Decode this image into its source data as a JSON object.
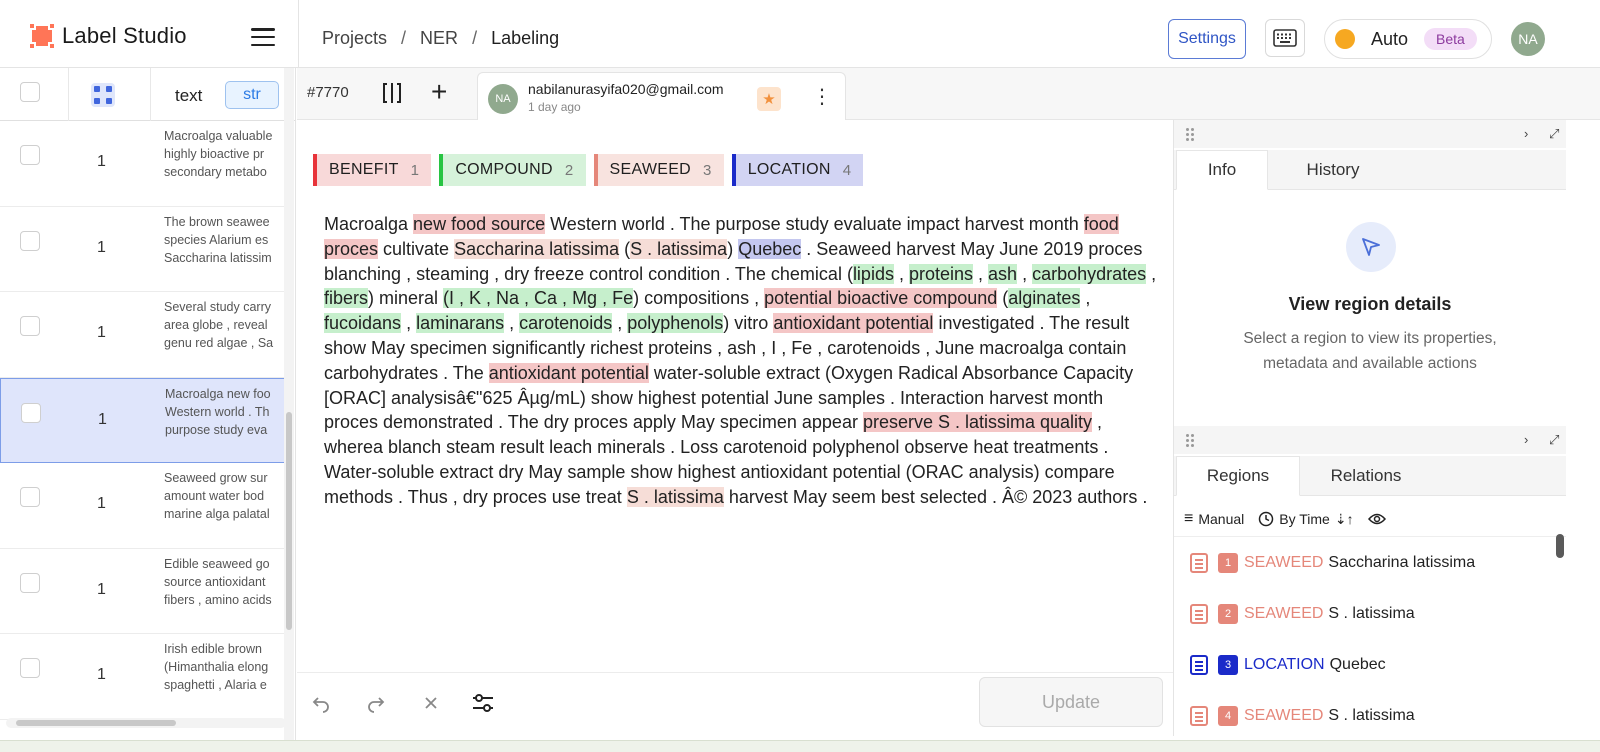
{
  "app": {
    "name": "Label Studio",
    "avatar_initials": "NA",
    "brand_color": "#ff7557"
  },
  "breadcrumb": [
    "Projects",
    "NER",
    "Labeling"
  ],
  "breadcrumb_sep": "/",
  "topbar": {
    "settings_label": "Settings",
    "auto_label": "Auto",
    "beta_label": "Beta",
    "keyboard_icon": "keyboard-icon",
    "menu_icon": "hamburger-icon"
  },
  "tasklist": {
    "columns": {
      "text": "text",
      "type_badge": "str"
    },
    "rows": [
      {
        "count": "1",
        "lines": [
          "Macroalga valuable",
          "highly bioactive pr",
          "secondary metabo"
        ],
        "selected": false
      },
      {
        "count": "1",
        "lines": [
          "The brown seawee",
          "species Alarium es",
          "Saccharina latissim"
        ],
        "selected": false
      },
      {
        "count": "1",
        "lines": [
          "Several study carry",
          "area globe , reveal",
          "genu red algae , Sa"
        ],
        "selected": false
      },
      {
        "count": "1",
        "lines": [
          "Macroalga new foo",
          "Western world . Th",
          "purpose study eva"
        ],
        "selected": true
      },
      {
        "count": "1",
        "lines": [
          "Seaweed grow sur",
          "amount water bod",
          "marine alga palatal"
        ],
        "selected": false
      },
      {
        "count": "1",
        "lines": [
          "Edible seaweed go",
          "source antioxidant",
          "fibers , amino acids"
        ],
        "selected": false
      },
      {
        "count": "1",
        "lines": [
          "Irish edible brown",
          "(Himanthalia elong",
          "spaghetti , Alaria e"
        ],
        "selected": false
      }
    ]
  },
  "taskbar": {
    "task_id": "#7770",
    "annotator_email": "nabilanurasyifa020@gmail.com",
    "annotator_initials": "NA",
    "time_ago": "1 day ago"
  },
  "labels": [
    {
      "name": "BENEFIT",
      "hotkey": "1",
      "color": "#e8343a",
      "bg": "#f8d9d9"
    },
    {
      "name": "COMPOUND",
      "hotkey": "2",
      "color": "#27c442",
      "bg": "#d6f2da"
    },
    {
      "name": "SEAWEED",
      "hotkey": "3",
      "color": "#e5877a",
      "bg": "#f8e3df"
    },
    {
      "name": "LOCATION",
      "hotkey": "4",
      "color": "#1b2bc9",
      "bg": "#d2d4f3"
    }
  ],
  "document": [
    {
      "t": "Macroalga "
    },
    {
      "t": "new food source",
      "l": "ben"
    },
    {
      "t": " Western world . The purpose study evaluate impact harvest month "
    },
    {
      "t": "food proces",
      "l": "ben"
    },
    {
      "t": " cultivate "
    },
    {
      "t": "Saccharina latissima",
      "l": "sea"
    },
    {
      "t": " ("
    },
    {
      "t": "S . latissima",
      "l": "sea"
    },
    {
      "t": ") "
    },
    {
      "t": "Quebec",
      "l": "loc"
    },
    {
      "t": " . Seaweed harvest May June 2019 proces blanching , steaming , dry freeze control condition . The chemical ("
    },
    {
      "t": "lipids",
      "l": "com"
    },
    {
      "t": " , "
    },
    {
      "t": "proteins",
      "l": "com"
    },
    {
      "t": " , "
    },
    {
      "t": "ash",
      "l": "com"
    },
    {
      "t": " , "
    },
    {
      "t": "carbohydrates",
      "l": "com"
    },
    {
      "t": " , "
    },
    {
      "t": "fibers",
      "l": "com"
    },
    {
      "t": ") mineral "
    },
    {
      "t": "(I , K , Na , Ca , Mg , Fe",
      "l": "com"
    },
    {
      "t": ") compositions , "
    },
    {
      "t": "potential bioactive compound",
      "l": "ben"
    },
    {
      "t": " ("
    },
    {
      "t": "alginates",
      "l": "com"
    },
    {
      "t": " , "
    },
    {
      "t": "fucoidans",
      "l": "com"
    },
    {
      "t": " , "
    },
    {
      "t": "laminarans",
      "l": "com"
    },
    {
      "t": " , "
    },
    {
      "t": "carotenoids",
      "l": "com"
    },
    {
      "t": " , "
    },
    {
      "t": "polyphenols",
      "l": "com"
    },
    {
      "t": ") vitro "
    },
    {
      "t": "antioxidant potential",
      "l": "ben"
    },
    {
      "t": " investigated . The result show May specimen significantly richest proteins , ash , I , Fe , carotenoids , June macroalga contain carbohydrates . The "
    },
    {
      "t": "antioxidant potential",
      "l": "ben"
    },
    {
      "t": " water-soluble extract (Oxygen Radical Absorbance Capacity [ORAC] analysisâ€\"625 Âµg/mL) show highest potential June samples . Interaction harvest month proces demonstrated . The dry proces apply May specimen appear "
    },
    {
      "t": "preserve S . latissima quality",
      "l": "ben"
    },
    {
      "t": " , wherea blanch steam result leach minerals . Loss carotenoid polyphenol observe heat treatments . Water-soluble extract dry May sample show highest antioxidant potential (ORAC analysis) compare methods . Thus , dry proces use treat "
    },
    {
      "t": "S . latissima",
      "l": "sea"
    },
    {
      "t": " harvest May seem best selected . Â© 2023 authors ."
    }
  ],
  "footer": {
    "update_label": "Update"
  },
  "right_panel": {
    "tabs_top": [
      "Info",
      "History"
    ],
    "empty_title": "View region details",
    "empty_desc": "Select a region to view its properties, metadata and available actions",
    "tabs_bottom": [
      "Regions",
      "Relations"
    ],
    "sort": {
      "manual": "Manual",
      "by_time": "By Time"
    },
    "regions": [
      {
        "index": "1",
        "label": "SEAWEED",
        "text": "Saccharina latissima",
        "color": "#e5877a"
      },
      {
        "index": "2",
        "label": "SEAWEED",
        "text": "S . latissima",
        "color": "#e5877a"
      },
      {
        "index": "3",
        "label": "LOCATION",
        "text": "Quebec",
        "color": "#1b2bc9"
      },
      {
        "index": "4",
        "label": "SEAWEED",
        "text": "S . latissima",
        "color": "#e5877a"
      }
    ]
  }
}
